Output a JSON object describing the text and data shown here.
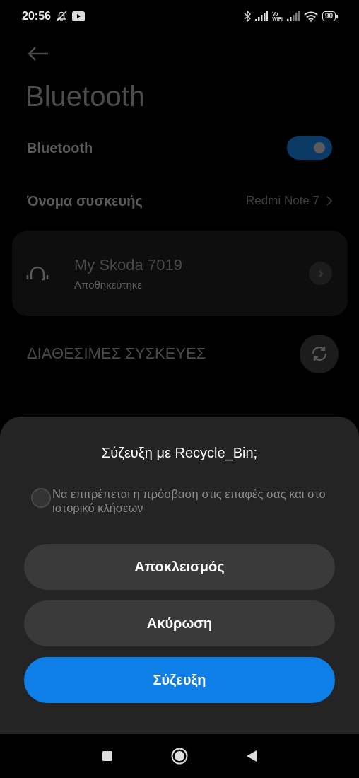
{
  "status_bar": {
    "time": "20:56",
    "vowifi_top": "Vo",
    "vowifi_bottom": "WiFi",
    "battery": "90"
  },
  "page": {
    "title": "Bluetooth"
  },
  "bluetooth_row": {
    "label": "Bluetooth",
    "on": true
  },
  "device_name_row": {
    "label": "Όνομα συσκευής",
    "value": "Redmi Note 7"
  },
  "saved_devices": [
    {
      "name": "My Skoda 7019",
      "status": "Αποθηκεύτηκε"
    }
  ],
  "available_section": {
    "label": "ΔΙΑΘΕΣΙΜΕΣ ΣΥΣΚΕΥΕΣ"
  },
  "dialog": {
    "title": "Σύζευξη με Recycle_Bin;",
    "checkbox": {
      "label": "Να επιτρέπεται η πρόσβαση στις επαφές σας και στο ιστορικό κλήσεων",
      "checked": false
    },
    "buttons": [
      {
        "label": "Αποκλεισμός",
        "kind": "secondary"
      },
      {
        "label": "Ακύρωση",
        "kind": "secondary"
      },
      {
        "label": "Σύζευξη",
        "kind": "primary"
      }
    ]
  }
}
